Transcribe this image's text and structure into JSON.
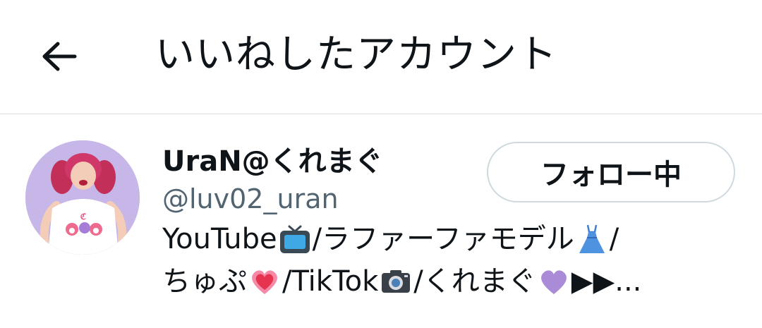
{
  "header": {
    "back_icon": "arrow-left-icon",
    "title": "いいねしたアカウント"
  },
  "user": {
    "display_name": "UraN@くれまぐ",
    "handle": "@luv02_uran",
    "follow_button_label": "フォロー中",
    "avatar_icon": "user-avatar",
    "bio": {
      "line1": {
        "part1": "YouTube",
        "icon1": "tv-emoji",
        "part2": "/ラファーファモデル",
        "icon2": "dress-emoji",
        "part3": "/"
      },
      "line2": {
        "part1": "ちゅぷ",
        "icon1": "heart-emoji",
        "part2": "/TikTok",
        "icon2": "camera-emoji",
        "part3": "/くれまぐ",
        "icon3": "purple-heart-emoji",
        "part4": "▶▶..."
      }
    }
  },
  "colors": {
    "text_primary": "#0f1419",
    "text_secondary": "#536471",
    "border": "#cfd9de",
    "divider": "#d9dde1"
  }
}
